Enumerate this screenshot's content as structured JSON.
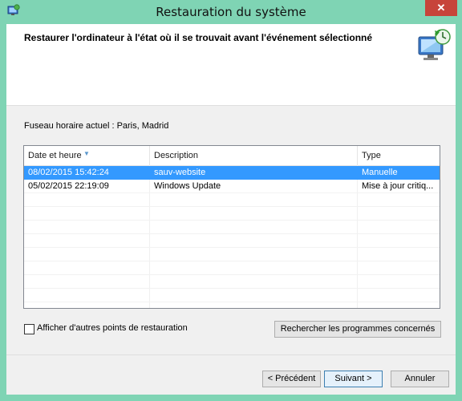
{
  "window": {
    "title": "Restauration du système",
    "close_label": "✕"
  },
  "header": {
    "title": "Restaurer l'ordinateur à l'état où il se trouvait avant l'événement sélectionné"
  },
  "timezone_label": "Fuseau horaire actuel : Paris, Madrid",
  "table": {
    "columns": [
      "Date et heure",
      "Description",
      "Type"
    ],
    "rows": [
      {
        "date": "08/02/2015 15:42:24",
        "description": "sauv-website",
        "type": "Manuelle",
        "selected": true
      },
      {
        "date": "05/02/2015 22:19:09",
        "description": "Windows Update",
        "type": "Mise à jour critiq...",
        "selected": false
      }
    ]
  },
  "show_more_label": "Afficher d'autres points de restauration",
  "show_more_checked": false,
  "buttons": {
    "scan": "Rechercher les programmes concernés",
    "back": "< Précédent",
    "next": "Suivant >",
    "cancel": "Annuler"
  },
  "icons": {
    "app": "system-restore-icon",
    "header": "monitor-restore-icon"
  },
  "colors": {
    "frame": "#7fd4b4",
    "selection": "#3399ff",
    "close": "#c7443a"
  }
}
